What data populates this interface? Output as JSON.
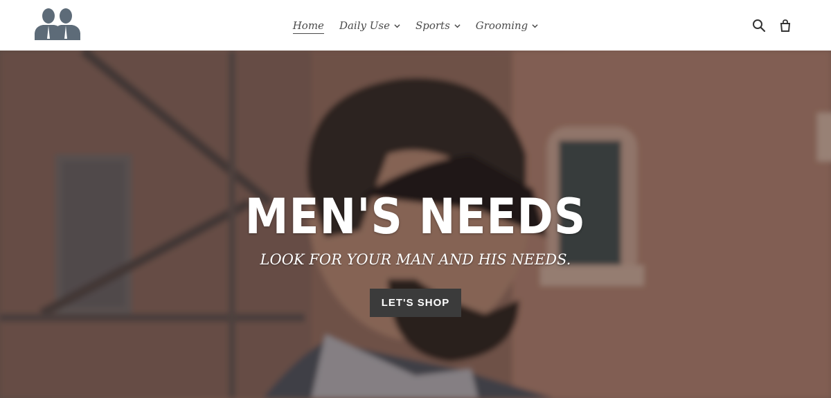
{
  "header": {
    "logo_icon": "two-men-silhouette-icon",
    "nav": [
      {
        "label": "Home",
        "active": true,
        "has_dropdown": false
      },
      {
        "label": "Daily Use",
        "active": false,
        "has_dropdown": true
      },
      {
        "label": "Sports",
        "active": false,
        "has_dropdown": true
      },
      {
        "label": "Grooming",
        "active": false,
        "has_dropdown": true
      }
    ],
    "icons": [
      "search-icon",
      "cart-icon"
    ]
  },
  "hero": {
    "title": "MEN'S NEEDS",
    "subtitle": "LOOK FOR YOUR MAN AND HIS NEEDS.",
    "button_label": "LET'S SHOP",
    "button_color": "#3b3b3b"
  }
}
